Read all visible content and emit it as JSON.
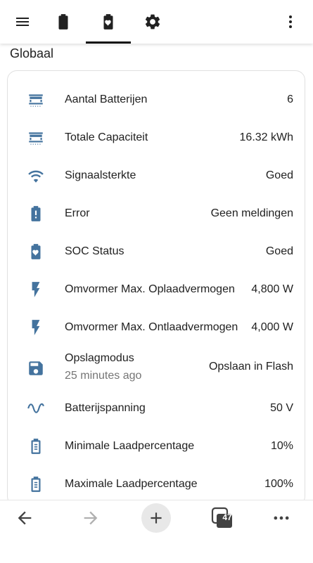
{
  "section": {
    "title": "Globaal"
  },
  "tabs": [
    {
      "name": "battery-tab"
    },
    {
      "name": "battery-heart-tab",
      "active": true
    },
    {
      "name": "settings-tab"
    }
  ],
  "rows": [
    {
      "icon": "battery-rack-icon",
      "label": "Aantal Batterijen",
      "value": "6"
    },
    {
      "icon": "battery-rack-icon",
      "label": "Totale Capaciteit",
      "value": "16.32 kWh"
    },
    {
      "icon": "wifi-icon",
      "label": "Signaalsterkte",
      "value": "Goed"
    },
    {
      "icon": "battery-alert-icon",
      "label": "Error",
      "value": "Geen meldingen"
    },
    {
      "icon": "battery-heart-icon",
      "label": "SOC Status",
      "value": "Goed"
    },
    {
      "icon": "flash-icon",
      "label": "Omvormer Max. Oplaadvermogen",
      "value": "4,800 W"
    },
    {
      "icon": "flash-icon",
      "label": "Omvormer Max. Ontlaadvermogen",
      "value": "4,000 W"
    },
    {
      "icon": "content-save-icon",
      "label": "Opslagmodus",
      "sub": "25 minutes ago",
      "value": "Opslaan in Flash"
    },
    {
      "icon": "sine-wave-icon",
      "label": "Batterijspanning",
      "value": "50 V"
    },
    {
      "icon": "battery-outline-icon",
      "label": "Minimale Laadpercentage",
      "value": "10%"
    },
    {
      "icon": "battery-outline-icon",
      "label": "Maximale Laadpercentage",
      "value": "100%"
    }
  ],
  "browser": {
    "tab_count": "47"
  },
  "colors": {
    "icon": "#44739e",
    "text": "#212121",
    "secondary": "#757575",
    "toolbar_icon": "#212121"
  }
}
